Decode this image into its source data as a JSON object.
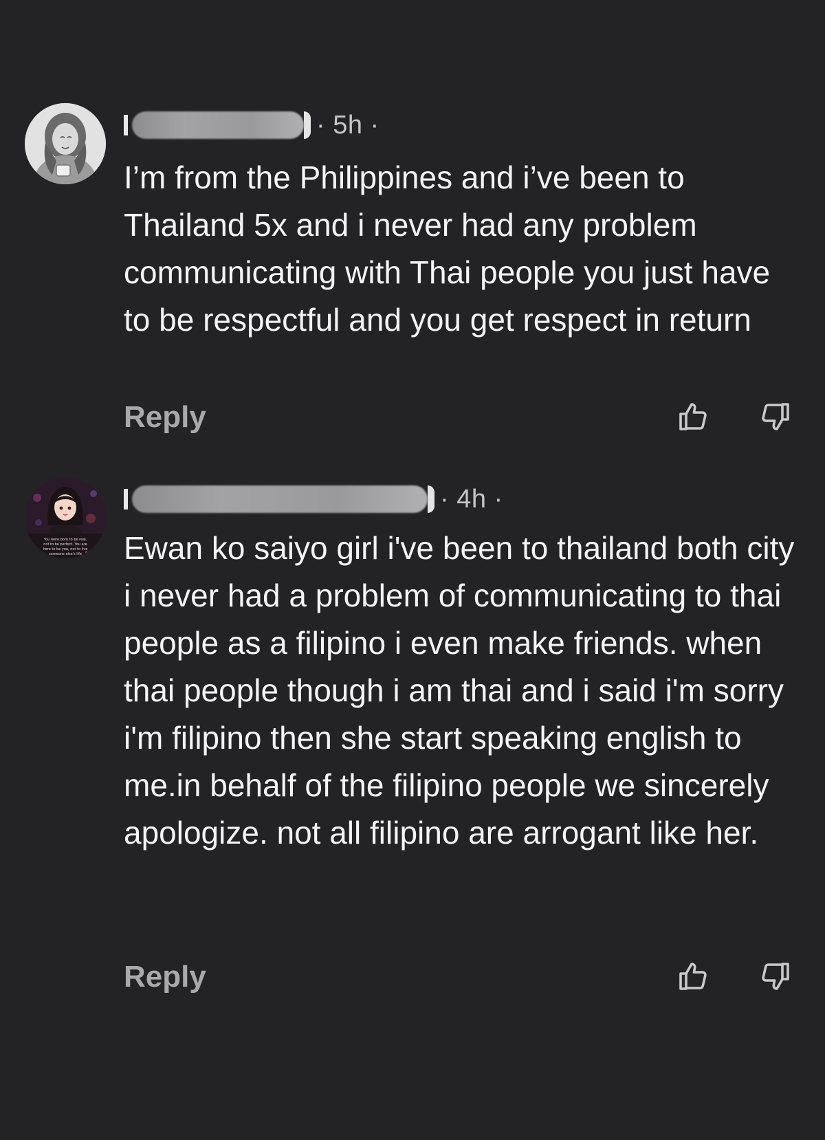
{
  "comments": [
    {
      "time": "· 5h ·",
      "text": "I’m from the Philippines and i’ve been to Thailand 5x and i never had any problem communicating with Thai people you just have to be respectful and you get respect in return",
      "reply_label": "Reply",
      "avatar_icon": "profile-photo-sketch",
      "like_icon": "thumbs-up-icon",
      "dislike_icon": "thumbs-down-icon"
    },
    {
      "time": "· 4h ·",
      "text": "Ewan ko saiyo girl i've been to thailand both city i never had a problem of communicating to thai people as a filipino  i even make friends. when thai people though i am thai and i said i'm sorry i'm filipino then she start speaking english to me.in behalf of the filipino people we sincerely apologize. not all  filipino are arrogant like her.",
      "reply_label": "Reply",
      "avatar_icon": "profile-photo-illustration",
      "avatar_caption": "You were born to be real, not to be perfect. You are here to be you, not to live someone else's life",
      "like_icon": "thumbs-up-icon",
      "dislike_icon": "thumbs-down-icon"
    }
  ],
  "colors": {
    "background": "#232326",
    "text": "#f4f4f5",
    "secondary": "#a9a9ac"
  }
}
